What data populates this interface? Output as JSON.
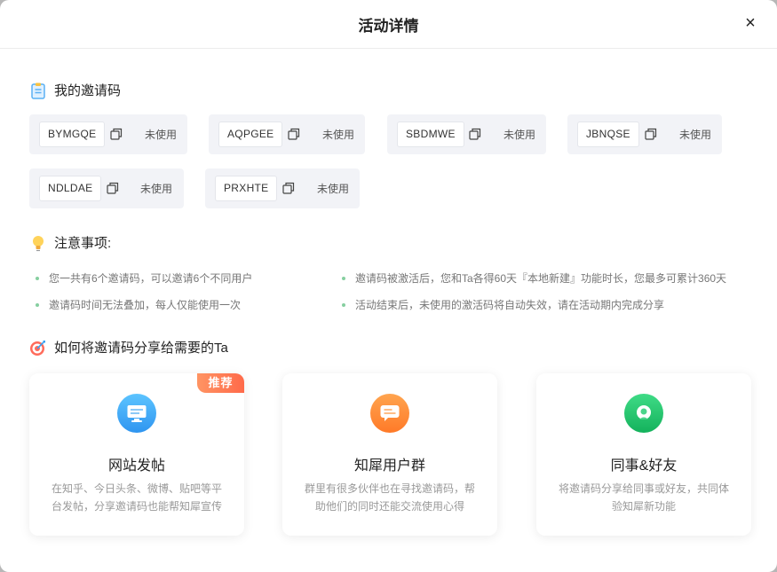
{
  "dialog": {
    "title": "活动详情",
    "close_label": "×"
  },
  "my_codes": {
    "heading": "我的邀请码",
    "icon": "clipboard-icon",
    "items": [
      {
        "code": "BYMGQE",
        "status": "未使用"
      },
      {
        "code": "AQPGEE",
        "status": "未使用"
      },
      {
        "code": "SBDMWE",
        "status": "未使用"
      },
      {
        "code": "JBNQSE",
        "status": "未使用"
      },
      {
        "code": "NDLDAE",
        "status": "未使用"
      },
      {
        "code": "PRXHTE",
        "status": "未使用"
      }
    ]
  },
  "notes": {
    "heading": "注意事项:",
    "icon": "lightbulb-icon",
    "items": [
      "您一共有6个邀请码，可以邀请6个不同用户",
      "邀请码被激活后，您和Ta各得60天『本地新建』功能时长，您最多可累计360天",
      "邀请码时间无法叠加，每人仅能使用一次",
      "活动结束后，未使用的激活码将自动失效，请在活动期内完成分享"
    ]
  },
  "share": {
    "heading": "如何将邀请码分享给需要的Ta",
    "icon": "target-icon",
    "badge": "推荐",
    "cards": [
      {
        "title": "网站发帖",
        "desc": "在知乎、今日头条、微博、贴吧等平台发帖，分享邀请码也能帮知犀宣传",
        "icon": "monitor-icon",
        "color": "#3ba7f5"
      },
      {
        "title": "知犀用户群",
        "desc": "群里有很多伙伴也在寻找邀请码，帮助他们的同时还能交流使用心得",
        "icon": "chat-icon",
        "color": "#ff8a2e"
      },
      {
        "title": "同事&好友",
        "desc": "将邀请码分享给同事或好友，共同体验知犀新功能",
        "icon": "user-icon",
        "color": "#22c46b"
      }
    ]
  }
}
